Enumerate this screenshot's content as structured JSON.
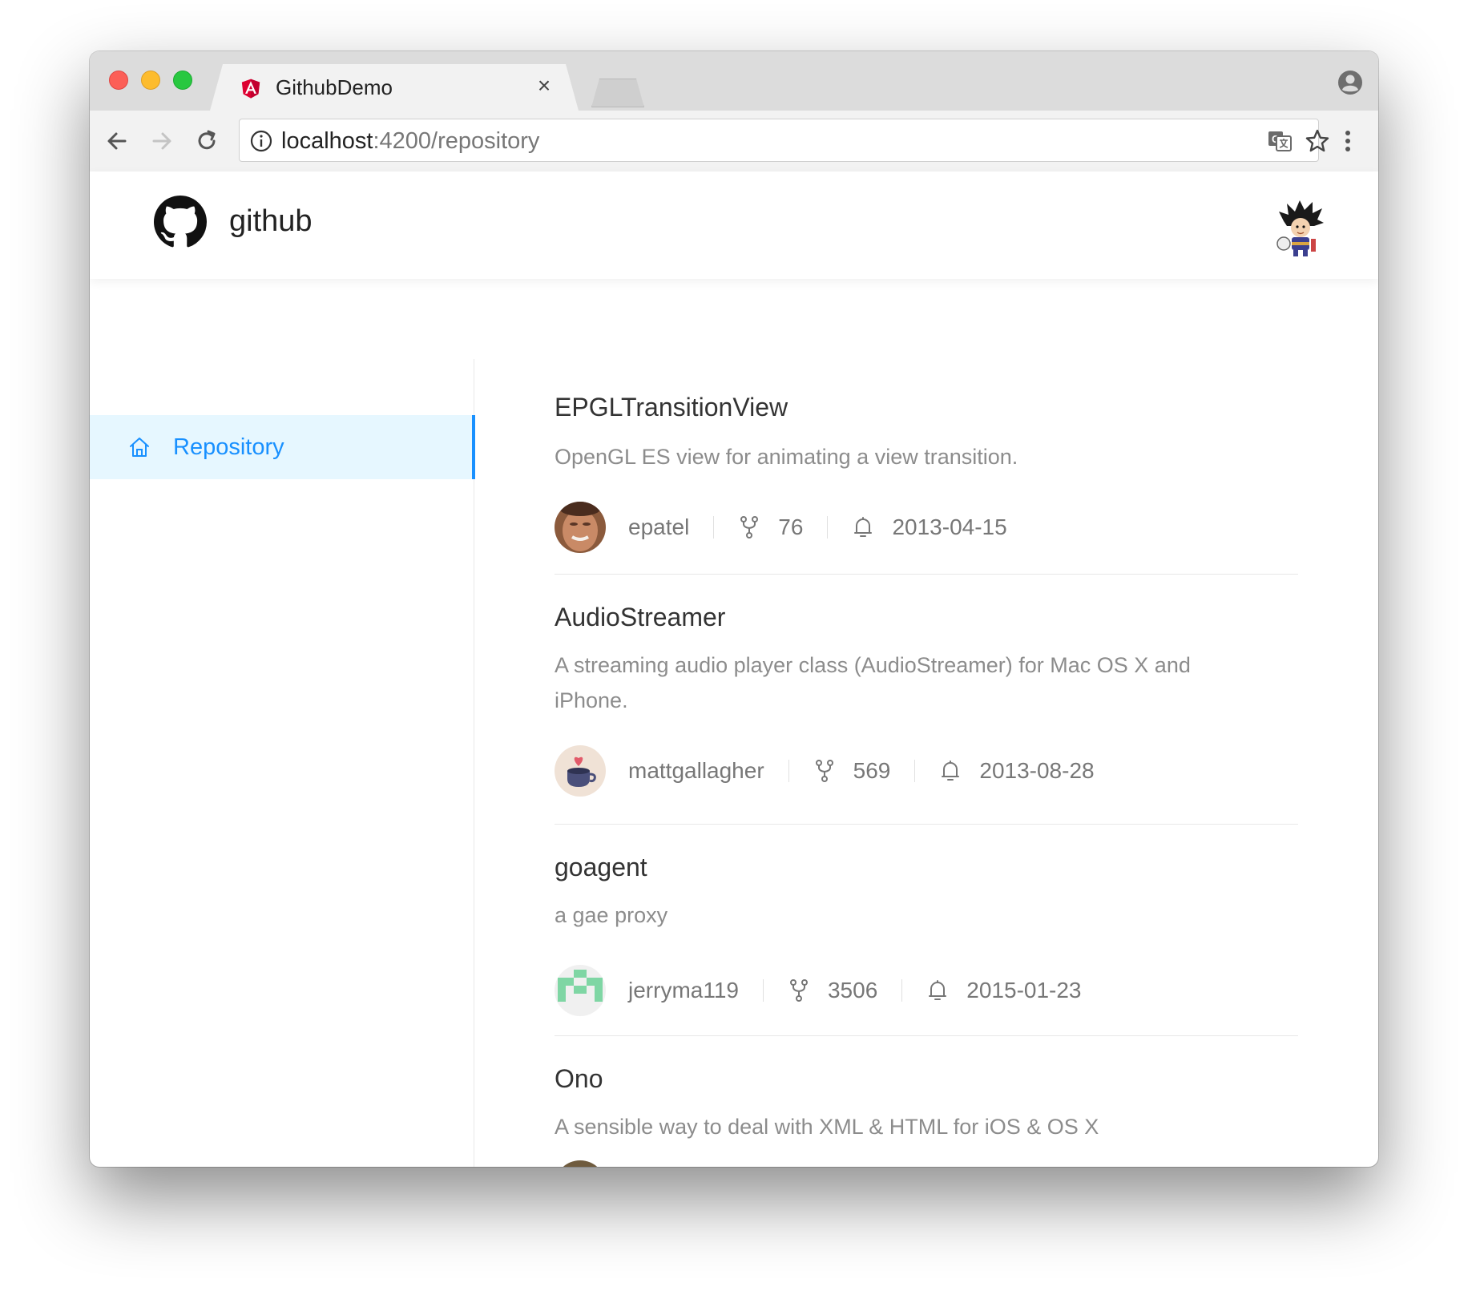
{
  "browser": {
    "tab_title": "GithubDemo",
    "tab_close": "×",
    "url_host": "localhost",
    "url_path": ":4200/repository"
  },
  "header": {
    "brand": "github"
  },
  "sidebar": {
    "items": [
      {
        "label": "Repository",
        "icon": "home-icon",
        "active": true
      }
    ]
  },
  "repositories": [
    {
      "name": "EPGLTransitionView",
      "description": "OpenGL ES view for animating a view transition.",
      "owner": "epatel",
      "forks": "76",
      "date": "2013-04-15"
    },
    {
      "name": "AudioStreamer",
      "description": "A streaming audio player class (AudioStreamer) for Mac OS X and iPhone.",
      "owner": "mattgallagher",
      "forks": "569",
      "date": "2013-08-28"
    },
    {
      "name": "goagent",
      "description": "a gae proxy",
      "owner": "jerryma119",
      "forks": "3506",
      "date": "2015-01-23"
    },
    {
      "name": "Ono",
      "description": "A sensible way to deal with XML & HTML for iOS & OS X"
    }
  ],
  "colors": {
    "accent": "#1890ff",
    "active_bg": "#e6f7ff",
    "angular_red": "#dd0031"
  }
}
